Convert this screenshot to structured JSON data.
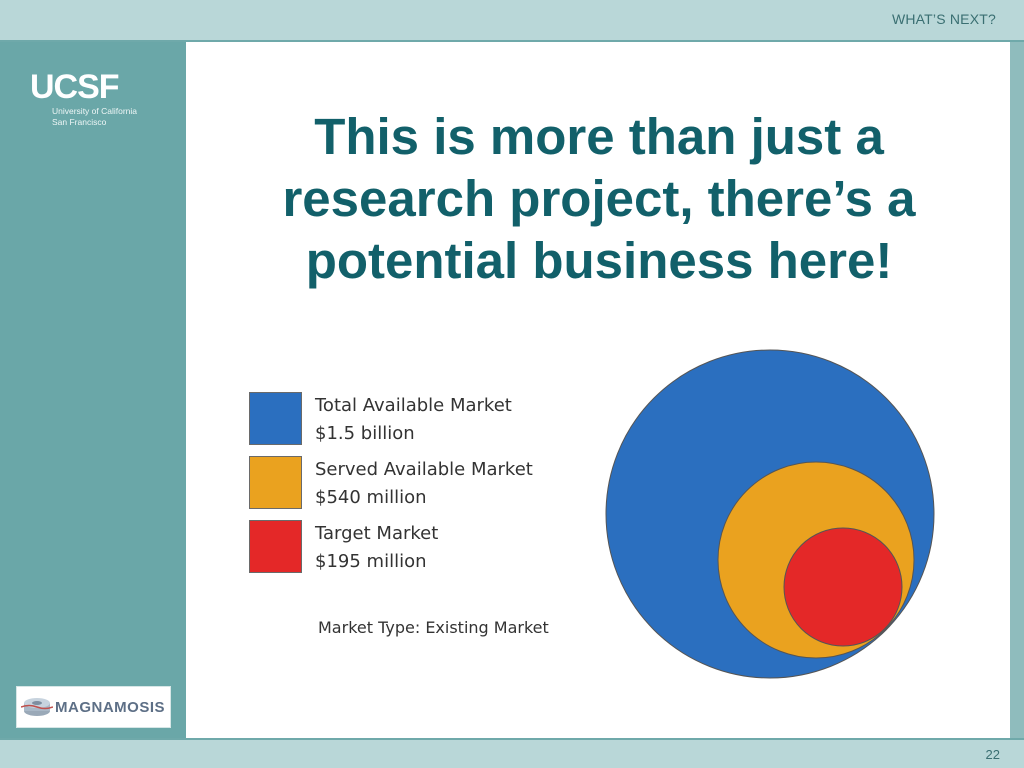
{
  "header": {
    "section_label": "WHAT’S NEXT?"
  },
  "sidebar": {
    "logo_ucsf": {
      "wordmark": "UCSF",
      "line1": "University of California",
      "line2": "San Francisco"
    },
    "logo_magnamosis": {
      "name": "MAGNAMOSIS"
    }
  },
  "slide": {
    "title_line1": "This is more than just a",
    "title_line2": "research project, there’s a",
    "title_line3": "potential business here!"
  },
  "legend": {
    "items": [
      {
        "name": "Total Available Market",
        "value": "$1.5 billion",
        "color": "#2b6fbf"
      },
      {
        "name": "Served Available Market",
        "value": "$540 million",
        "color": "#eaa21f"
      },
      {
        "name": "Target Market",
        "value": "$195 million",
        "color": "#e42828"
      }
    ],
    "market_type": "Market Type: Existing Market"
  },
  "footer": {
    "page_number": "22"
  }
}
